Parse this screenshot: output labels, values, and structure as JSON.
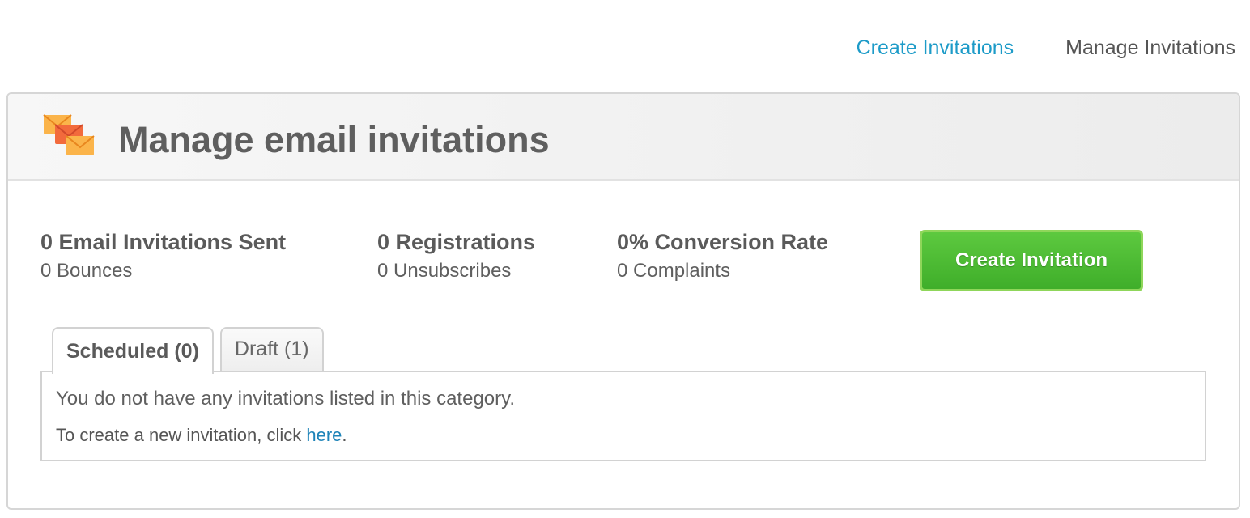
{
  "top_nav": {
    "create_label": "Create Invitations",
    "manage_label": "Manage Invitations"
  },
  "header": {
    "title": "Manage email invitations",
    "icon": "envelopes-icon"
  },
  "stats": [
    {
      "main": "0 Email Invitations Sent",
      "sub": "0 Bounces"
    },
    {
      "main": "0 Registrations",
      "sub": "0 Unsubscribes"
    },
    {
      "main": "0% Conversion Rate",
      "sub": "0 Complaints"
    }
  ],
  "create_button_label": "Create Invitation",
  "tabs": [
    {
      "label": "Scheduled (0)",
      "active": true
    },
    {
      "label": "Draft (1)",
      "active": false
    }
  ],
  "tab_content": {
    "empty_message": "You do not have any invitations listed in this category.",
    "hint_prefix": "To create a new invitation, click ",
    "hint_link": "here",
    "hint_suffix": "."
  },
  "colors": {
    "link": "#1d9bc8",
    "button_green": "#4cbc35",
    "icon_orange": "#f08a3a"
  }
}
